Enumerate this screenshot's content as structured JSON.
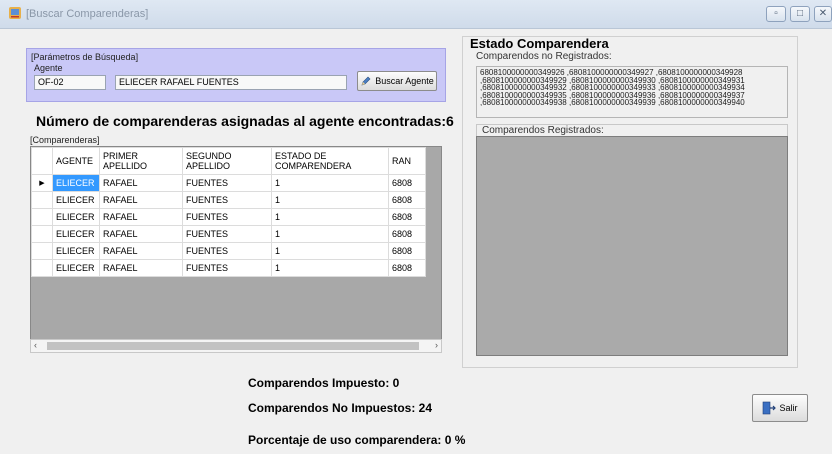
{
  "window": {
    "title": "[Buscar Comparenderas]"
  },
  "params": {
    "legend": "[Parámetros de Búsqueda]",
    "agent_label": "Agente",
    "agent_code": "OF-02",
    "agent_name": "ELIECER RAFAEL FUENTES",
    "search_button": "Buscar Agente"
  },
  "main": {
    "heading": "Número de comparenderas asignadas al agente encontradas:6",
    "grid_legend": "[Comparenderas]"
  },
  "grid": {
    "columns": [
      "AGENTE",
      "PRIMER APELLIDO",
      "SEGUNDO APELLIDO",
      "ESTADO DE COMPARENDERA",
      "RAN"
    ],
    "rows": [
      [
        "ELIECER",
        "RAFAEL",
        "FUENTES",
        "1",
        "6808"
      ],
      [
        "ELIECER",
        "RAFAEL",
        "FUENTES",
        "1",
        "6808"
      ],
      [
        "ELIECER",
        "RAFAEL",
        "FUENTES",
        "1",
        "6808"
      ],
      [
        "ELIECER",
        "RAFAEL",
        "FUENTES",
        "1",
        "6808"
      ],
      [
        "ELIECER",
        "RAFAEL",
        "FUENTES",
        "1",
        "6808"
      ],
      [
        "ELIECER",
        "RAFAEL",
        "FUENTES",
        "1",
        "6808"
      ]
    ]
  },
  "estado": {
    "title": "Estado Comparendera",
    "no_registrados_label": "Comparendos no Registrados:",
    "no_registrados_lines": [
      "6808100000000349926 ,6808100000000349927 ,6808100000000349928",
      ",6808100000000349929 ,6808100000000349930 ,6808100000000349931",
      ",6808100000000349932 ,6808100000000349933 ,6808100000000349934",
      ",6808100000000349935 ,6808100000000349936 ,6808100000000349937",
      ",6808100000000349938 ,6808100000000349939 ,6808100000000349940"
    ],
    "registrados_label": "Comparendos Registrados:"
  },
  "stats": {
    "impuesto": "Comparendos Impuesto: 0",
    "no_impuestos": "Comparendos No Impuestos: 24",
    "porcentaje": "Porcentaje de uso comparendera: 0 %"
  },
  "footer": {
    "exit_button": "Salir"
  },
  "colors": {
    "selected_cell": "#3399ff",
    "param_panel": "#c9c8f7",
    "grid_empty": "#a8a8a8"
  }
}
